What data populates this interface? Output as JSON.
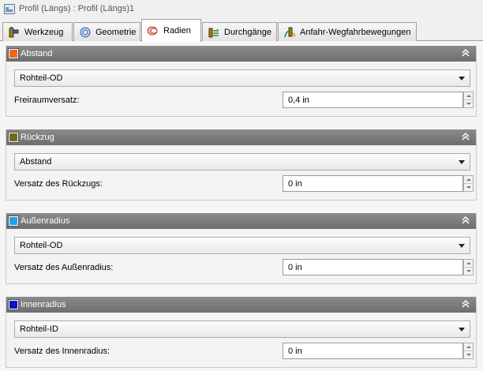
{
  "window": {
    "title": "Profil (Längs) : Profil (Längs)1",
    "icon": "profile-dialog-icon"
  },
  "tabs": [
    {
      "label": "Werkzeug",
      "icon": "tool-icon",
      "active": false
    },
    {
      "label": "Geometrie",
      "icon": "geometry-icon",
      "active": false
    },
    {
      "label": "Radien",
      "icon": "radii-icon",
      "active": true
    },
    {
      "label": "Durchgänge",
      "icon": "passes-icon",
      "active": false
    },
    {
      "label": "Anfahr-Wegfahrbewegungen",
      "icon": "linking-icon",
      "active": false
    }
  ],
  "panels": [
    {
      "title": "Abstand",
      "color": "#f26522",
      "dropdown": "Rohteil-OD",
      "field_label": "Freiraumversatz:",
      "field_value": "0,4 in"
    },
    {
      "title": "Rückzug",
      "color": "#6b6b1a",
      "dropdown": "Abstand",
      "field_label": "Versatz des Rückzugs:",
      "field_value": "0 in"
    },
    {
      "title": "Außenradius",
      "color": "#1fa3e8",
      "dropdown": "Rohteil-OD",
      "field_label": "Versatz des Außenradius:",
      "field_value": "0 in"
    },
    {
      "title": "Innenradius",
      "color": "#1010c8",
      "dropdown": "Rohteil-ID",
      "field_label": "Versatz des Innenradius:",
      "field_value": "0 in"
    }
  ]
}
